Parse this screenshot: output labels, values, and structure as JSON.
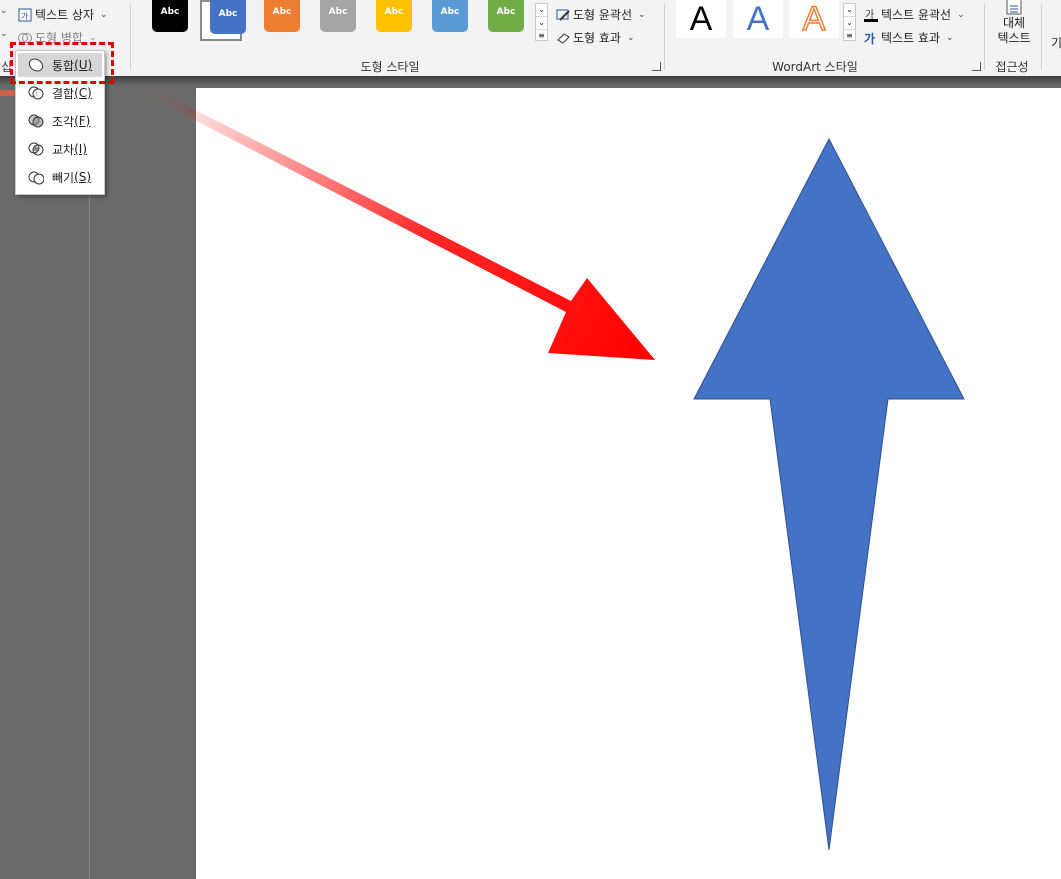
{
  "ribbon": {
    "insert_shapes": {
      "text_box_label": "텍스트 상자",
      "merge_shapes_label": "도형 병합"
    },
    "shape_styles": {
      "group_label": "도형 스타일",
      "swatches": [
        {
          "label": "Abc",
          "color": "#000000"
        },
        {
          "label": "Abc",
          "color": "#4472c4"
        },
        {
          "label": "Abc",
          "color": "#ed7d31"
        },
        {
          "label": "Abc",
          "color": "#a5a5a5"
        },
        {
          "label": "Abc",
          "color": "#ffc000"
        },
        {
          "label": "Abc",
          "color": "#5b9bd5"
        },
        {
          "label": "Abc",
          "color": "#70ad47"
        }
      ],
      "outline_label": "도형 윤곽선",
      "effects_label": "도형 효과"
    },
    "wordart_styles": {
      "group_label": "WordArt 스타일",
      "letters": [
        "A",
        "A",
        "A"
      ],
      "text_outline_label": "텍스트 윤곽선",
      "text_effects_label": "텍스트 효과"
    },
    "accessibility": {
      "group_label": "접근성",
      "alt_text_label_line1": "대체",
      "alt_text_label_line2": "텍스트"
    },
    "left_group_label": "삽",
    "cut_label": "기"
  },
  "merge_menu": {
    "items": [
      {
        "label": "통합",
        "key": "(U)",
        "icon": "union-icon"
      },
      {
        "label": "결합",
        "key": "(C)",
        "icon": "combine-icon"
      },
      {
        "label": "조각",
        "key": "(F)",
        "icon": "fragment-icon"
      },
      {
        "label": "교차",
        "key": "(I)",
        "icon": "intersect-icon"
      },
      {
        "label": "빼기",
        "key": "(S)",
        "icon": "subtract-icon"
      }
    ]
  },
  "colors": {
    "arrow_shape": "#4472c4",
    "annotation_red": "#ff0000",
    "highlight_border": "#e00000"
  }
}
